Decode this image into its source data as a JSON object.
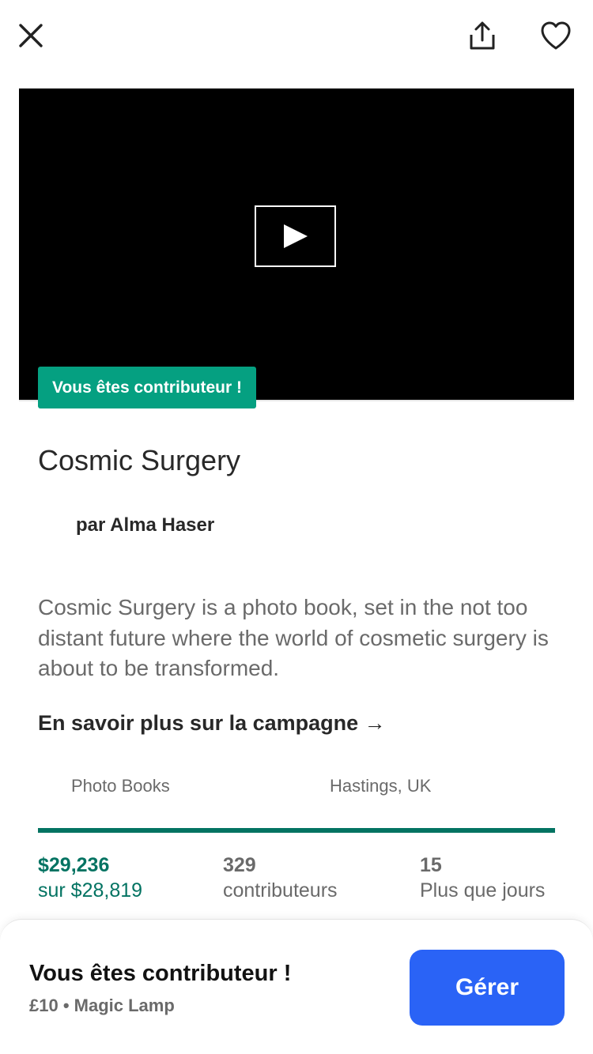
{
  "header": {
    "close_icon": "close-icon",
    "share_icon": "share-icon",
    "favorite_icon": "heart-icon"
  },
  "video": {
    "play_icon": "play-icon",
    "backer_tag": "Vous êtes contributeur !"
  },
  "project": {
    "title": "Cosmic Surgery",
    "creator": "par Alma Haser",
    "blurb": "Cosmic Surgery is a photo book, set in the not too distant future where the world of cosmetic surgery is about to be transformed.",
    "learn_more": "En savoir plus sur la campagne →",
    "category": "Photo Books",
    "location": "Hastings, UK"
  },
  "stats": {
    "pledged": "$29,236",
    "goal": "sur $28,819",
    "backers_count": "329",
    "backers_label": "contributeurs",
    "days_count": "15",
    "days_label": "Plus que jours",
    "progress_fraction": 1.0
  },
  "bottom_sheet": {
    "title": "Vous êtes contributeur !",
    "reward": "£10 • Magic Lamp",
    "manage_label": "Gérer"
  },
  "colors": {
    "accent_green": "#05a081",
    "dark_green": "#037362",
    "button_blue": "#2a63f6"
  }
}
